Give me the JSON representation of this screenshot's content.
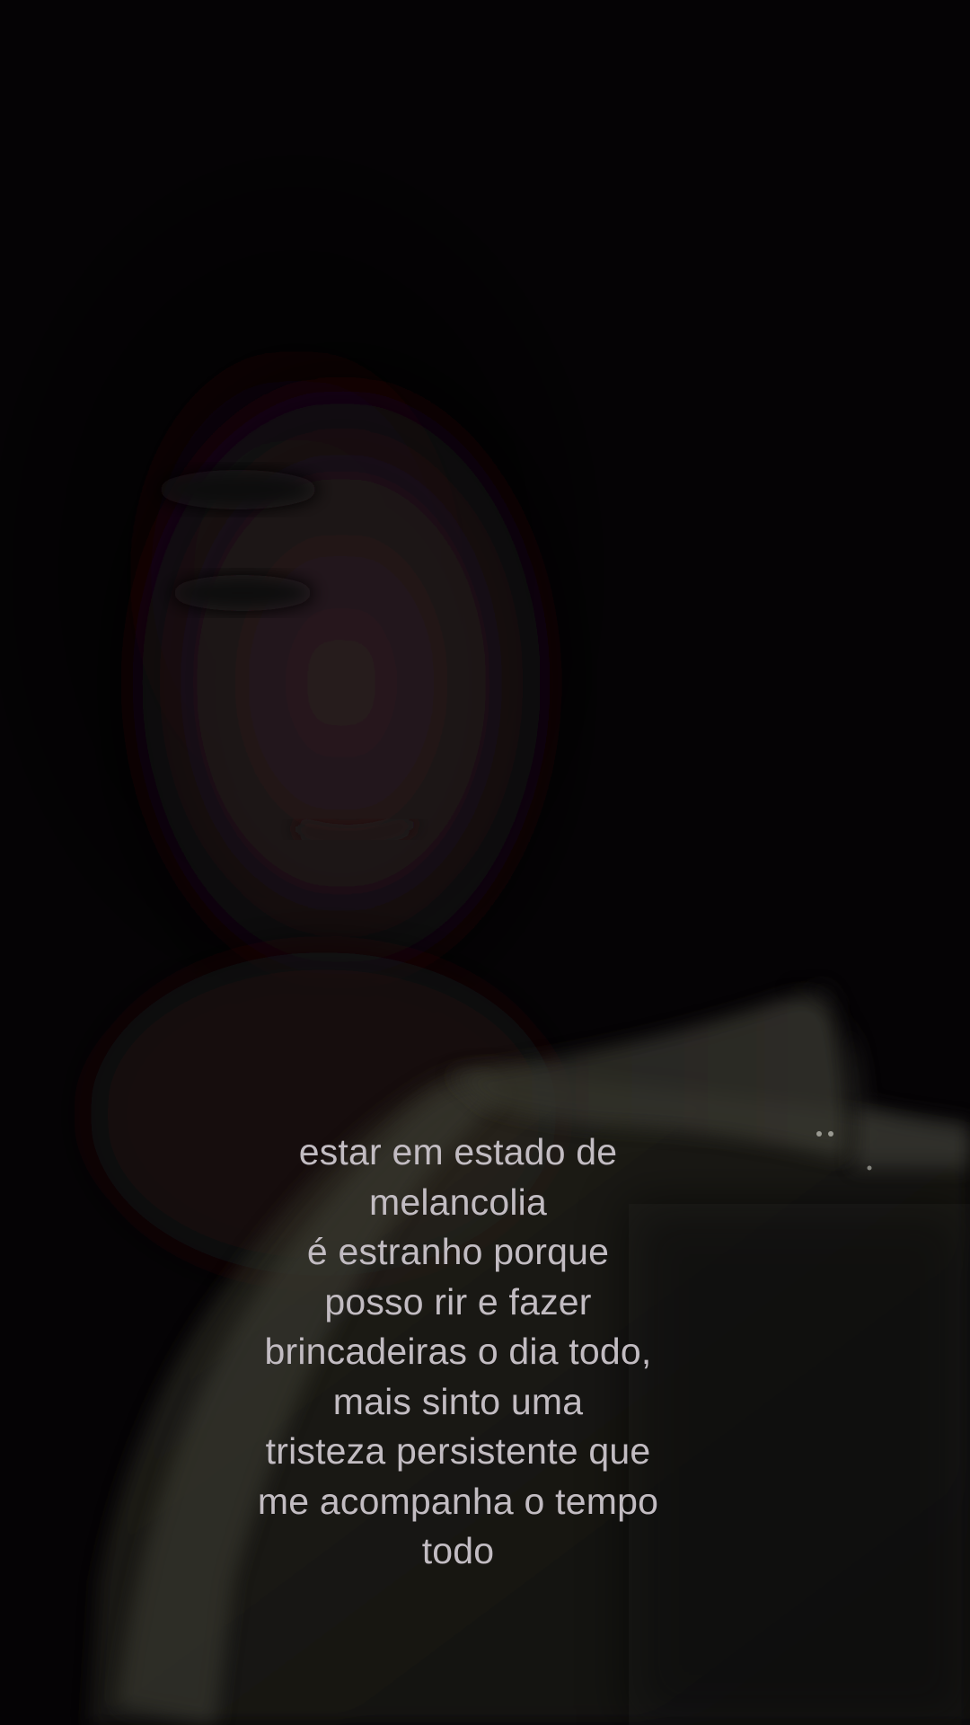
{
  "caption": {
    "lines": [
      "estar em estado de",
      "melancolia",
      "é estranho porque",
      "posso rir e fazer",
      "brincadeiras o dia todo,",
      "mais sinto uma",
      "tristeza persistente que",
      "me acompanha o tempo",
      "todo"
    ]
  },
  "colors": {
    "background": "#050305",
    "caption_text": "#c2bcc2"
  }
}
